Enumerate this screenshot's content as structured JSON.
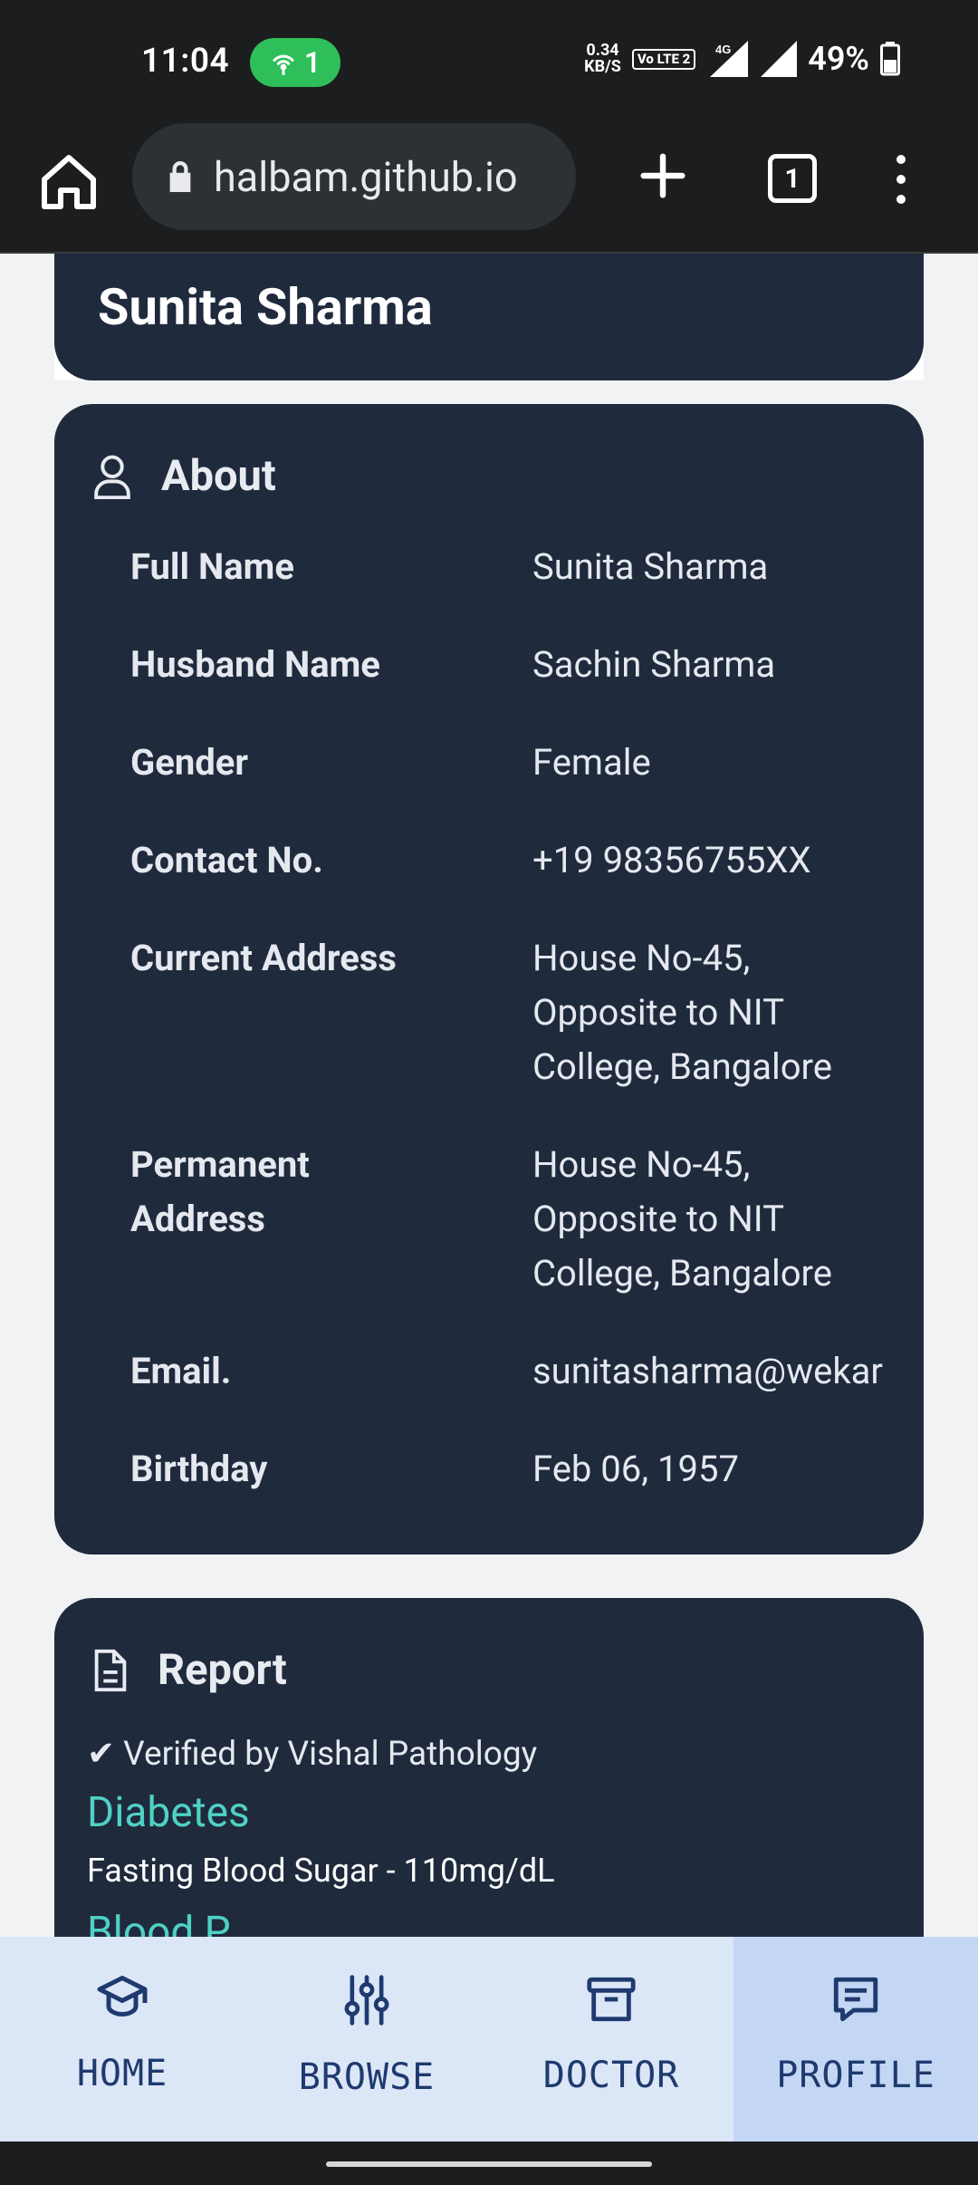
{
  "status_bar": {
    "time": "11:04",
    "hotspot_count": "1",
    "speed_value": "0.34",
    "speed_unit": "KB/S",
    "volte": "Vo LTE 2",
    "network": "4G",
    "battery": "49%"
  },
  "browser": {
    "url": "halbam.github.io",
    "tab_count": "1"
  },
  "profile": {
    "name": "Sunita Sharma"
  },
  "about": {
    "title": "About",
    "rows": [
      {
        "label": "Full Name",
        "value": "Sunita Sharma"
      },
      {
        "label": "Husband Name",
        "value": "Sachin Sharma"
      },
      {
        "label": "Gender",
        "value": "Female"
      },
      {
        "label": "Contact No.",
        "value": "+19 98356755XX"
      },
      {
        "label": "Current Address",
        "value": "House No-45,\nOpposite to NIT\nCollege, Bangalore"
      },
      {
        "label": "Permanent\nAddress",
        "value": "House No-45,\nOpposite to NIT\nCollege, Bangalore"
      },
      {
        "label": "Email.",
        "value": "sunitasharma@wekar"
      },
      {
        "label": "Birthday",
        "value": "Feb 06, 1957"
      }
    ]
  },
  "report": {
    "title": "Report",
    "verified": "✔ Verified by Vishal Pathology",
    "conditions": [
      {
        "name": "Diabetes",
        "detail": "Fasting Blood Sugar - 110mg/dL"
      },
      {
        "name": "Blood P"
      }
    ]
  },
  "bottom_nav": {
    "items": [
      {
        "label": "HOME",
        "icon": "graduation-cap-icon"
      },
      {
        "label": "BROWSE",
        "icon": "sliders-icon"
      },
      {
        "label": "DOCTOR",
        "icon": "archive-box-icon"
      },
      {
        "label": "PROFILE",
        "icon": "message-icon",
        "active": true
      }
    ]
  },
  "colors": {
    "card": "#1f2a3d",
    "accent_teal": "#4fd1c5",
    "nav_bg": "#dbe6f7",
    "nav_active": "#c3d7f5",
    "nav_text": "#1e3a6e"
  }
}
